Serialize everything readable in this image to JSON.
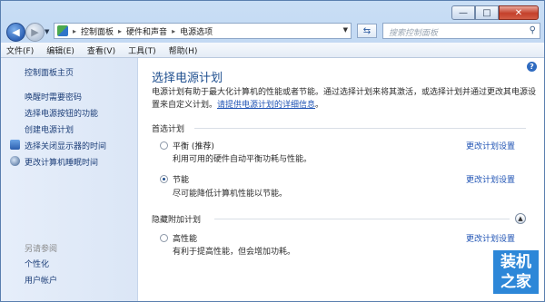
{
  "window": {
    "buttons": {
      "minimize": "—",
      "maximize": "□",
      "close": "✕"
    }
  },
  "address": {
    "crumbs": [
      "控制面板",
      "硬件和声音",
      "电源选项"
    ],
    "search_placeholder": "搜索控制面板"
  },
  "menu": [
    "文件(F)",
    "编辑(E)",
    "查看(V)",
    "工具(T)",
    "帮助(H)"
  ],
  "sidebar": {
    "home": "控制面板主页",
    "items": [
      "唤醒时需要密码",
      "选择电源按钮的功能",
      "创建电源计划",
      "选择关闭显示器的时间",
      "更改计算机睡眠时间"
    ],
    "see_also": "另请参阅",
    "related": [
      "个性化",
      "用户帐户"
    ]
  },
  "main": {
    "title": "选择电源计划",
    "intro": "电源计划有助于最大化计算机的性能或者节能。通过选择计划来将其激活，或选择计划并通过更改其电源设置来自定义计划。",
    "intro_link": "请提供电源计划的详细信息",
    "preferred_label": "首选计划",
    "hidden_label": "隐藏附加计划",
    "change_link": "更改计划设置",
    "plans": [
      {
        "name": "平衡 (推荐)",
        "desc": "利用可用的硬件自动平衡功耗与性能。",
        "checked": false
      },
      {
        "name": "节能",
        "desc": "尽可能降低计算机性能以节能。",
        "checked": true
      },
      {
        "name": "高性能",
        "desc": "有利于提高性能，但会增加功耗。",
        "checked": false
      }
    ]
  },
  "watermark": {
    "line1": "装机",
    "line2": "之家"
  }
}
